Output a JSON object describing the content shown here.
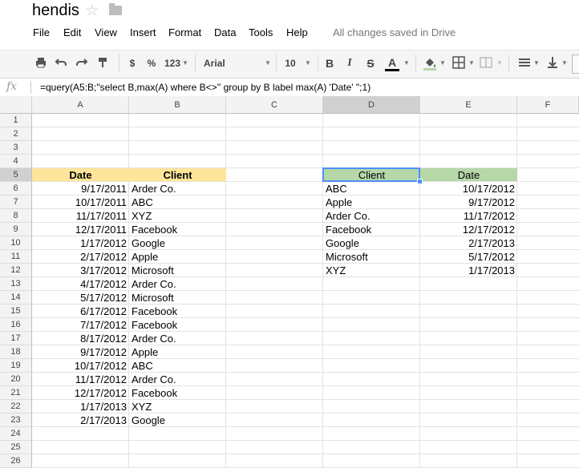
{
  "doc": {
    "title": "hendis",
    "status": "All changes saved in Drive"
  },
  "menu": [
    "File",
    "Edit",
    "View",
    "Insert",
    "Format",
    "Data",
    "Tools",
    "Help"
  ],
  "toolbar": {
    "currency": "$",
    "percent": "%",
    "number_format": "123",
    "font": "Arial",
    "font_size": "10",
    "bold": "B",
    "italic": "I",
    "strike": "S",
    "text_color": "A"
  },
  "formula_bar": {
    "label": "fx",
    "formula": "=query(A5:B;\"select B,max(A) where B<>'' group by B label max(A) 'Date' \";1)"
  },
  "columns": [
    "A",
    "B",
    "C",
    "D",
    "E",
    "F"
  ],
  "rows": [
    "1",
    "2",
    "3",
    "4",
    "5",
    "6",
    "7",
    "8",
    "9",
    "10",
    "11",
    "12",
    "13",
    "14",
    "15",
    "16",
    "17",
    "18",
    "19",
    "20",
    "21",
    "22",
    "23",
    "24",
    "25",
    "26"
  ],
  "table1": {
    "headers": [
      "Date",
      "Client"
    ],
    "rows": [
      [
        "9/17/2011",
        "Arder Co."
      ],
      [
        "10/17/2011",
        "ABC"
      ],
      [
        "11/17/2011",
        "XYZ"
      ],
      [
        "12/17/2011",
        "Facebook"
      ],
      [
        "1/17/2012",
        "Google"
      ],
      [
        "2/17/2012",
        "Apple"
      ],
      [
        "3/17/2012",
        "Microsoft"
      ],
      [
        "4/17/2012",
        "Arder Co."
      ],
      [
        "5/17/2012",
        "Microsoft"
      ],
      [
        "6/17/2012",
        "Facebook"
      ],
      [
        "7/17/2012",
        "Facebook"
      ],
      [
        "8/17/2012",
        "Arder Co."
      ],
      [
        "9/17/2012",
        "Apple"
      ],
      [
        "10/17/2012",
        "ABC"
      ],
      [
        "11/17/2012",
        "Arder Co."
      ],
      [
        "12/17/2012",
        "Facebook"
      ],
      [
        "1/17/2013",
        "XYZ"
      ],
      [
        "2/17/2013",
        "Google"
      ]
    ]
  },
  "table2": {
    "headers": [
      "Client",
      "Date"
    ],
    "rows": [
      [
        "ABC",
        "10/17/2012"
      ],
      [
        "Apple",
        "9/17/2012"
      ],
      [
        "Arder Co.",
        "11/17/2012"
      ],
      [
        "Facebook",
        "12/17/2012"
      ],
      [
        "Google",
        "2/17/2013"
      ],
      [
        "Microsoft",
        "5/17/2012"
      ],
      [
        "XYZ",
        "1/17/2013"
      ]
    ]
  },
  "colors": {
    "header_yellow": "#ffe599",
    "header_green": "#b6d7a8",
    "selection": "#4d90fe"
  }
}
